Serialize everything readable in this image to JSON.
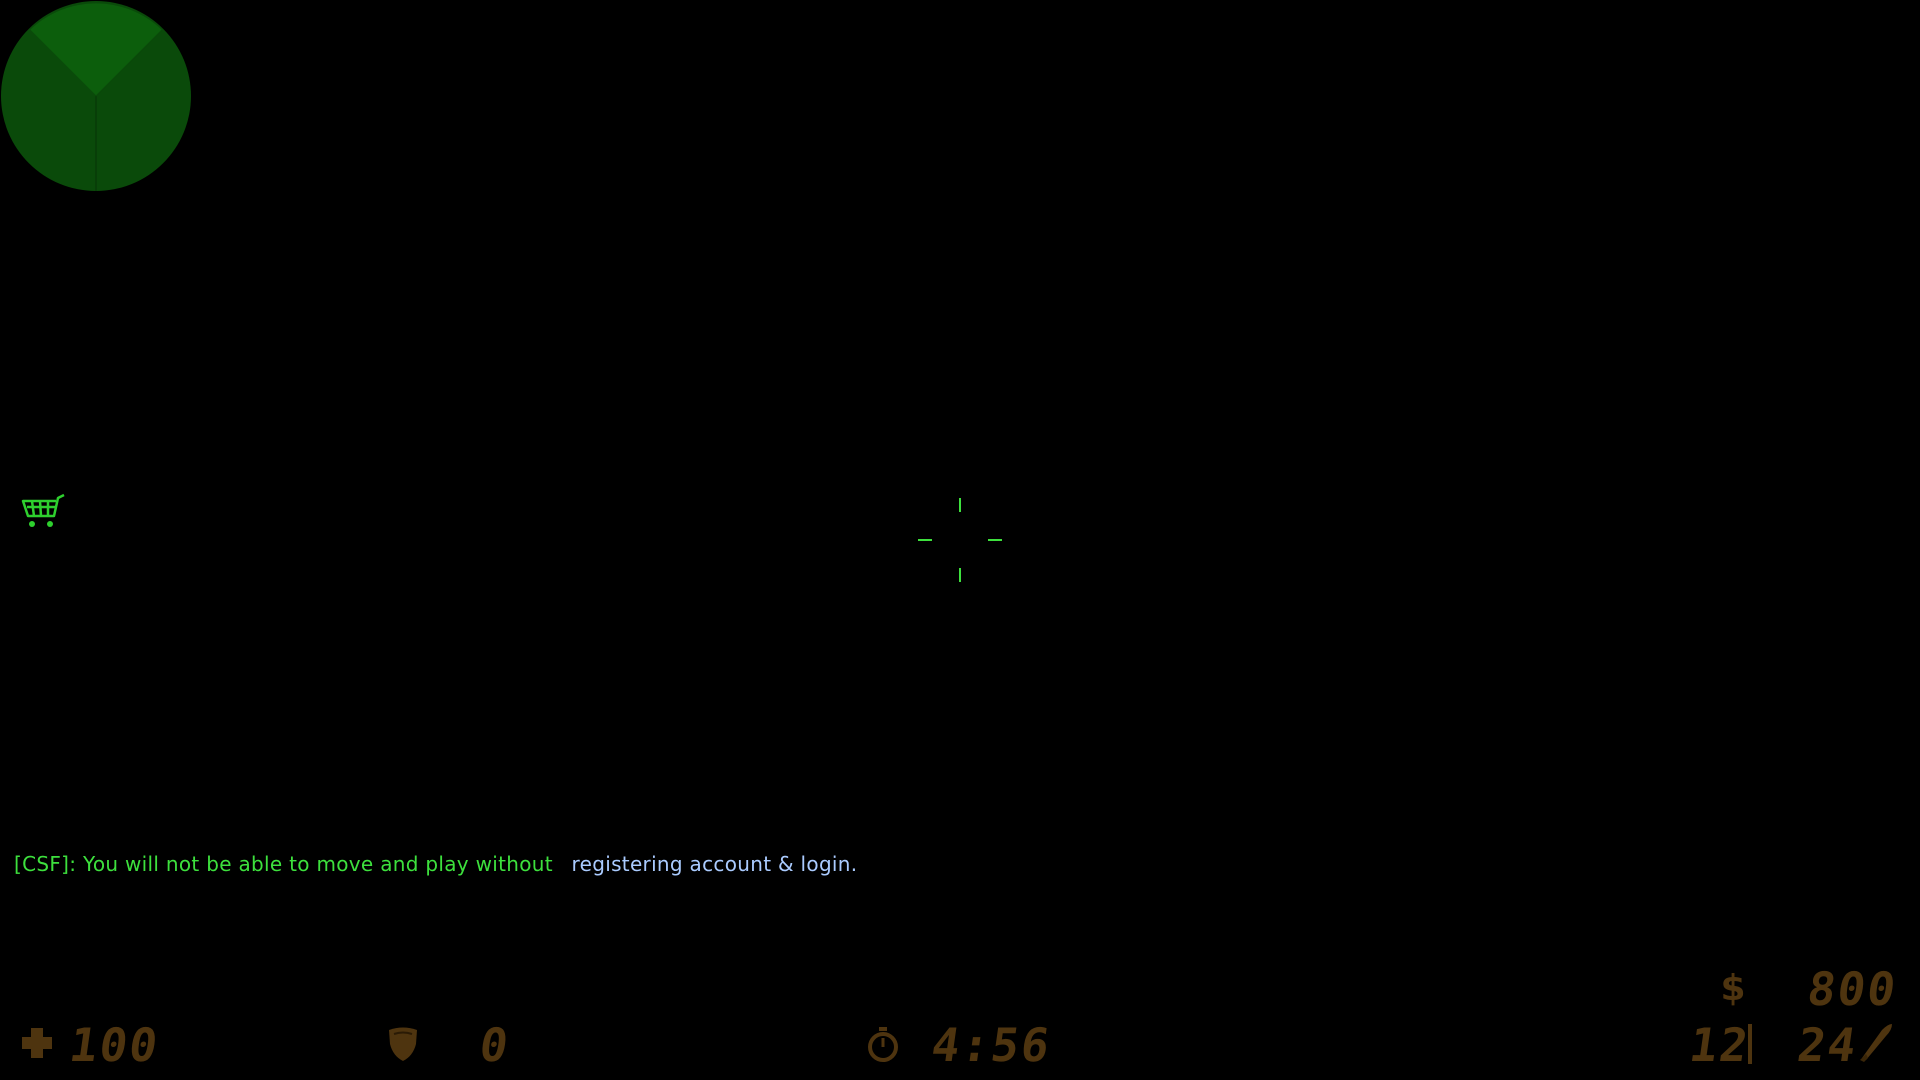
{
  "hud": {
    "health": {
      "icon": "cross-icon",
      "value": "100"
    },
    "armor": {
      "icon": "shield-icon",
      "value": "0"
    },
    "timer": {
      "icon": "stopwatch-icon",
      "value": "4:56"
    },
    "money": {
      "icon": "dollar-icon",
      "value": "800"
    },
    "ammo": {
      "icon": "bullet-icon",
      "clip": "12",
      "separator": "|",
      "reserve": "24"
    }
  },
  "chat": {
    "prefix": "[CSF]:",
    "message": "You will not be able to move and play without",
    "highlight": "registering account & login."
  },
  "radar": {
    "icon": "radar-icon"
  },
  "shop": {
    "icon": "shopping-cart-icon"
  },
  "crosshair": {
    "icon": "crosshair-icon"
  },
  "colors": {
    "background": "#000000",
    "radar": "#0a5a0a",
    "chat_green": "#3de03d",
    "chat_blue": "#aacbff",
    "hud_amber": "#4e340f",
    "crosshair": "#3de03d"
  }
}
